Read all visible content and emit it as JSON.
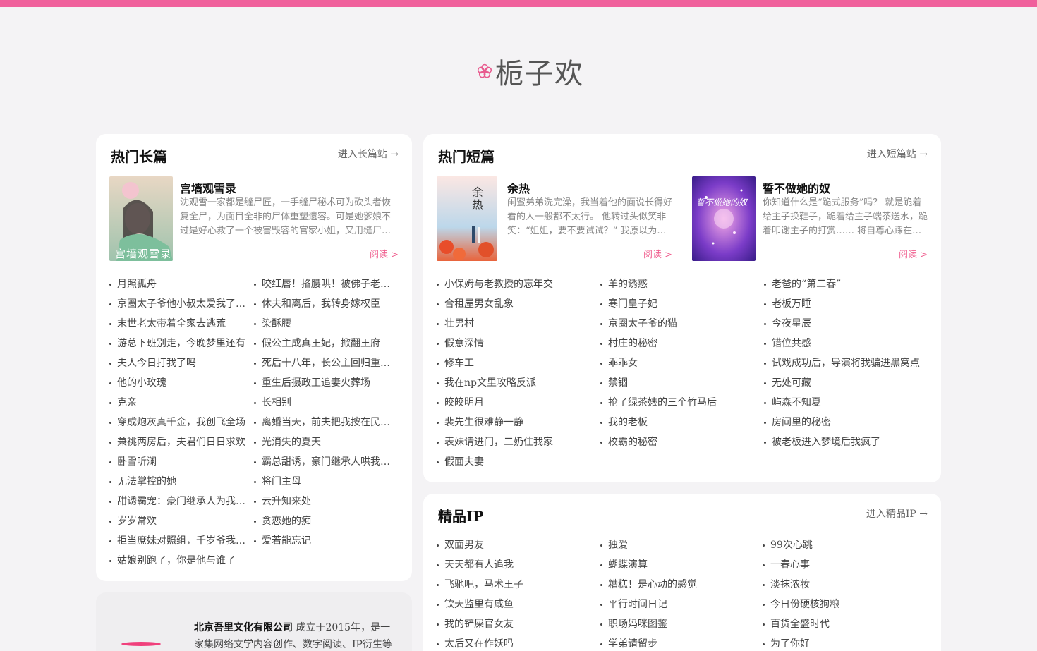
{
  "site": {
    "logo_text": "栀子欢",
    "accent": "#f0609c"
  },
  "long": {
    "title": "热门长篇",
    "link": "进入长篇站 →",
    "book": {
      "title": "宫墙观雪录",
      "cover_caption": "宫墙观雪录",
      "desc": "沈观雪一家都是缝尸匠，一手缝尸秘术可为砍头者恢复全尸，为面目全非的尸体重塑遗容。可是她爹娘不过是好心救了一个被害毁容的官家小姐，又用缝尸…",
      "read": "阅读 >"
    },
    "col1": [
      "月照孤舟",
      "京圈太子爷他小叔太爱我了…",
      "末世老太带着全家去逃荒",
      "游总下班别走，今晚梦里还有",
      "夫人今日打我了吗",
      "他的小玫瑰",
      "克亲",
      "穿成炮灰真千金，我创飞全场",
      "兼祧两房后，夫君们日日求欢",
      "卧雪听澜",
      "无法掌控的她",
      "甜诱霸宠：豪门继承人为我…",
      "岁岁常欢",
      "拒当庶妹对照组，千岁爷我…",
      "姑娘别跑了，你是他与谁了"
    ],
    "col2": [
      "咬红唇！掐腰哄！被佛子老…",
      "休夫和离后，我转身嫁权臣",
      "染酥腰",
      "假公主成真王妃，掀翻王府",
      "死后十八年，长公主回归重…",
      "重生后摄政王追妻火葬场",
      "长相别",
      "离婚当天，前夫把我按在民…",
      "光消失的夏天",
      "霸总甜诱，豪门继承人哄我…",
      "将门主母",
      "云升知来处",
      "贪恋她的痴",
      "爱若能忘记"
    ]
  },
  "short": {
    "title": "热门短篇",
    "link": "进入短篇站 →",
    "books": [
      {
        "title": "余热",
        "cover_caption": "余热",
        "desc": "闺蜜弟弟洗完澡，我当着他的面说长得好看的人一般都不太行。 他转过头似笑非笑：“姐姐，要不要试试？” 我原以为…",
        "read": "阅读 >"
      },
      {
        "title": "誓不做她的奴",
        "cover_caption": "誓不做她的奴",
        "desc": "你知道什么是“跪式服务”吗？ 就是跪着给主子换鞋子，跪着给主子端茶送水，跪着叩谢主子的打赏…… 将自尊心踩在…",
        "read": "阅读 >"
      }
    ],
    "col1": [
      "小保姆与老教授的忘年交",
      "合租屋男女乱象",
      "壮男村",
      "假意深情",
      "修车工",
      "我在np文里攻略反派",
      "皎皎明月",
      "裴先生很难静一静",
      "表妹请进门，二奶住我家",
      "假面夫妻"
    ],
    "col2": [
      "羊的诱惑",
      "寒门皇子妃",
      "京圈太子爷的猫",
      "村庄的秘密",
      "乖乖女",
      "禁锢",
      "抢了绿茶婊的三个竹马后",
      "我的老板",
      "校霸的秘密"
    ],
    "col3": [
      "老爸的“第二春”",
      "老板万睡",
      "今夜星辰",
      "错位共感",
      "试戏成功后，导演将我骗进黑窝点",
      "无处可藏",
      "屿森不知夏",
      "房间里的秘密",
      "被老板进入梦境后我疯了"
    ]
  },
  "ip": {
    "title": "精品IP",
    "link": "进入精品IP →",
    "col1": [
      "双面男友",
      "天天都有人追我",
      "飞驰吧，马术王子",
      "钦天监里有咸鱼",
      "我的铲屎官女友",
      "太后又在作妖吗"
    ],
    "col2": [
      "独爱",
      "蝴蝶演算",
      "糟糕！是心动的感觉",
      "平行时间日记",
      "职场妈咪图鉴",
      "学弟请留步"
    ],
    "col3": [
      "99次心跳",
      "一春心事",
      "淡抹浓妆",
      "今日份硬核狗粮",
      "百货全盛时代",
      "为了你好"
    ]
  },
  "company": {
    "name": "北京吾里文化有限公司",
    "desc": " 成立于2015年，是一家集网络文学内容创作、数字阅读、IP衍生等多"
  }
}
